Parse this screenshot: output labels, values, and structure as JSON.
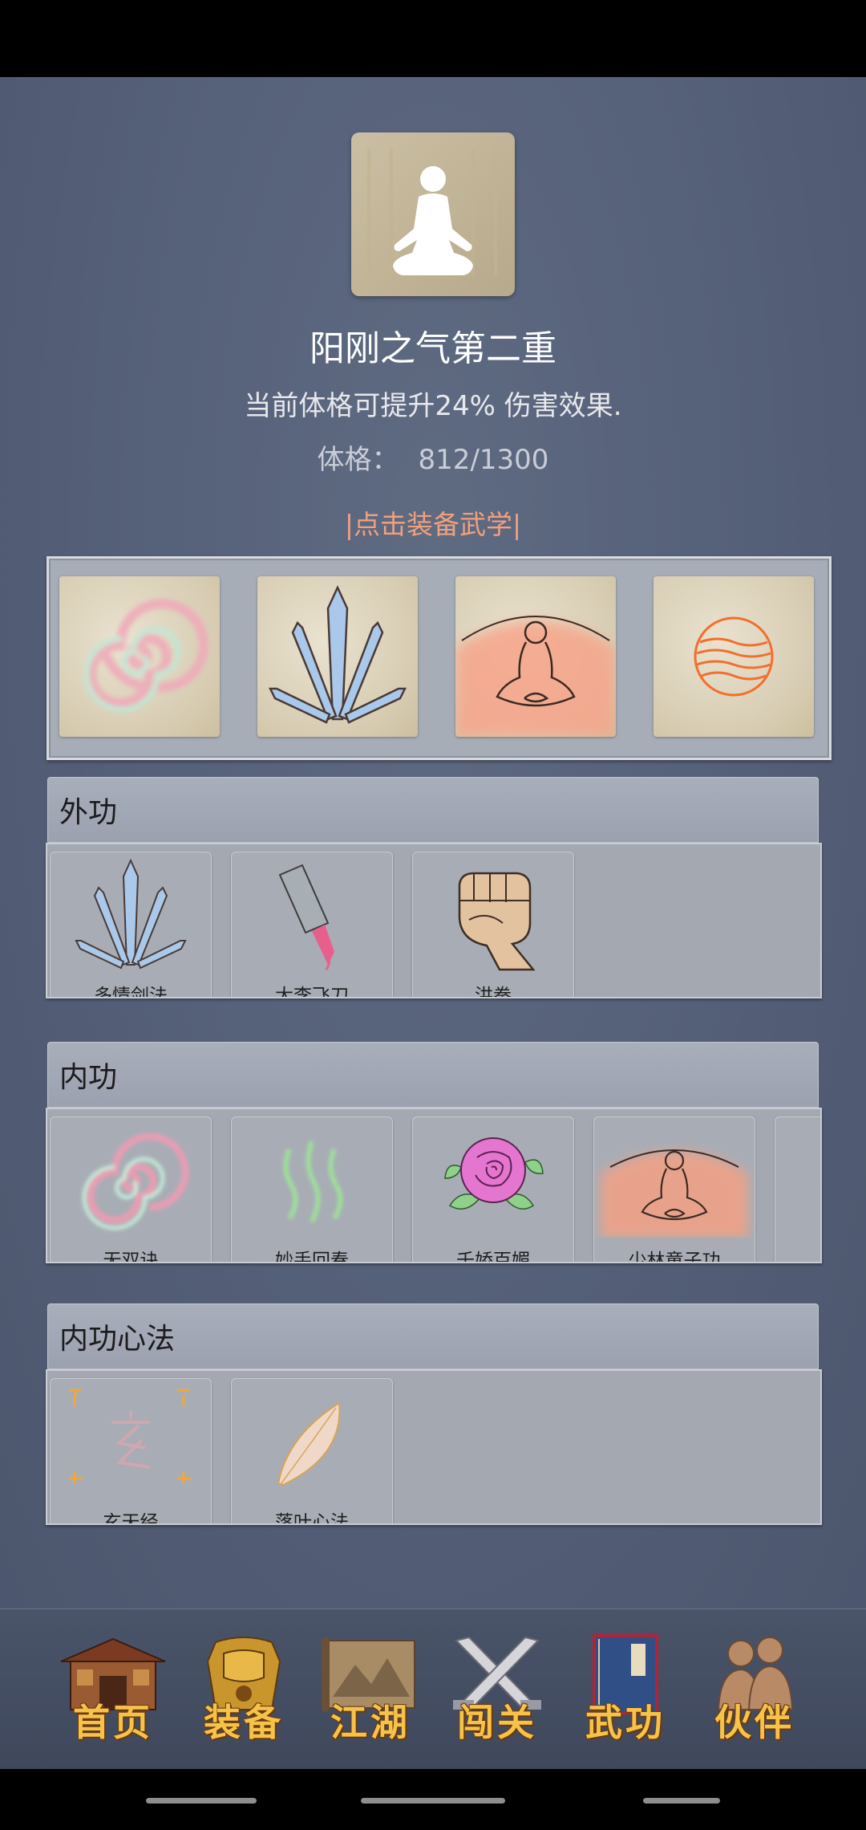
{
  "profile": {
    "realm": "阳刚之气第二重",
    "description": "当前体格可提升24% 伤害效果.",
    "stat_label": "体格：",
    "stat_value": "812/1300",
    "equip_hint": "|点击装备武学|"
  },
  "equipped_slots": [
    {
      "icon": "swirl-icon"
    },
    {
      "icon": "sword-fan-icon"
    },
    {
      "icon": "meditating-monk-icon"
    },
    {
      "icon": "fire-sphere-icon"
    }
  ],
  "sections": [
    {
      "title": "外功",
      "skills": [
        {
          "label": "多情剑法",
          "icon": "sword-fan-icon"
        },
        {
          "label": "大李飞刀",
          "icon": "flying-knife-icon"
        },
        {
          "label": "洪拳",
          "icon": "fist-icon"
        }
      ]
    },
    {
      "title": "内功",
      "skills": [
        {
          "label": "无双诀",
          "icon": "swirl-icon"
        },
        {
          "label": "妙手回春",
          "icon": "green-waves-icon"
        },
        {
          "label": "千娇百媚",
          "icon": "rose-icon"
        },
        {
          "label": "少林童子功",
          "icon": "meditating-monk-icon"
        },
        {
          "label": "",
          "icon": "partial-card"
        }
      ]
    },
    {
      "title": "内功心法",
      "skills": [
        {
          "label": "玄天经",
          "icon": "xuan-glyph-icon"
        },
        {
          "label": "落叶心法",
          "icon": "leaf-icon"
        }
      ]
    }
  ],
  "nav": [
    {
      "label": "首页",
      "icon": "temple-icon"
    },
    {
      "label": "装备",
      "icon": "armor-icon"
    },
    {
      "label": "江湖",
      "icon": "scroll-map-icon"
    },
    {
      "label": "闯关",
      "icon": "crossed-swords-icon"
    },
    {
      "label": "武功",
      "icon": "manual-book-icon"
    },
    {
      "label": "伙伴",
      "icon": "companions-icon"
    }
  ],
  "colors": {
    "background": "#56617a",
    "accent_hint": "#f1a07e",
    "nav_label": "#f6c34a"
  }
}
